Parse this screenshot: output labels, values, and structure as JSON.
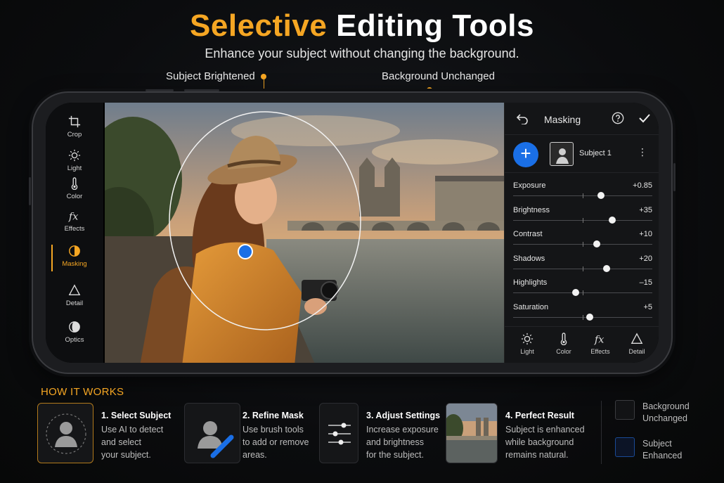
{
  "header": {
    "title_accent": "Selective",
    "title_main": "Editing Tools",
    "subtitle": "Enhance your subject without changing the background.",
    "callout_left": "Subject Brightened",
    "callout_right": "Background Unchanged"
  },
  "toolbar": {
    "items": [
      {
        "label": "Crop",
        "icon": "crop-icon"
      },
      {
        "label": "Light",
        "icon": "sun-icon"
      },
      {
        "label": "Color",
        "icon": "thermometer-icon"
      },
      {
        "label": "Effects",
        "icon": "fx-icon"
      },
      {
        "label": "Masking",
        "icon": "mask-icon",
        "active": true
      },
      {
        "label": "Detail",
        "icon": "triangle-icon"
      },
      {
        "label": "Optics",
        "icon": "lens-icon"
      }
    ]
  },
  "panel": {
    "title": "Masking",
    "subject_label": "Subject 1",
    "add_symbol": "+",
    "kebab": "⋮",
    "sliders": [
      {
        "label": "Exposure",
        "value": "+0.85",
        "level": 0.63
      },
      {
        "label": "Brightness",
        "value": "+35",
        "level": 0.71
      },
      {
        "label": "Contrast",
        "value": "+10",
        "level": 0.6
      },
      {
        "label": "Shadows",
        "value": "+20",
        "level": 0.67
      },
      {
        "label": "Highlights",
        "value": "–15",
        "level": 0.45
      },
      {
        "label": "Saturation",
        "value": "+5",
        "level": 0.55
      }
    ],
    "bottom_tabs": [
      {
        "label": "Light",
        "icon": "sun-icon"
      },
      {
        "label": "Color",
        "icon": "thermometer-icon"
      },
      {
        "label": "Effects",
        "icon": "fx-icon"
      },
      {
        "label": "Detail",
        "icon": "triangle-icon"
      }
    ]
  },
  "how_it_works": {
    "title": "HOW IT WORKS",
    "steps": [
      {
        "title": "1. Select Subject",
        "lines": [
          "Use AI to detect",
          "and select",
          "your subject."
        ]
      },
      {
        "title": "2. Refine Mask",
        "lines": [
          "Use brush tools",
          "to add or remove",
          "areas."
        ]
      },
      {
        "title": "3. Adjust Settings",
        "lines": [
          "Increase exposure",
          "and brightness",
          "for the subject."
        ]
      },
      {
        "title": "4. Perfect Result",
        "lines": [
          "Subject is enhanced",
          "while background",
          "remains natural."
        ]
      }
    ],
    "legend": [
      {
        "lines": [
          "Background",
          "Unchanged"
        ]
      },
      {
        "lines": [
          "Subject",
          "Enhanced"
        ]
      }
    ]
  },
  "colors": {
    "accent": "#f5a623",
    "brand_blue": "#1a6fe6"
  }
}
